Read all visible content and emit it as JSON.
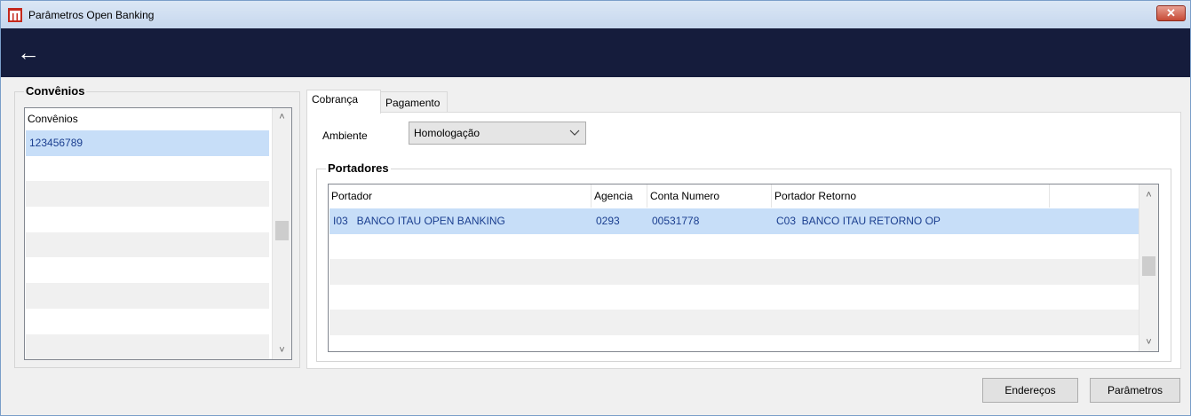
{
  "window": {
    "title": "Parâmetros Open Banking",
    "close_label": "✕"
  },
  "header": {
    "back_icon": "←"
  },
  "convenios": {
    "group_title": "Convênios",
    "column_header": "Convênios",
    "rows": [
      "123456789",
      "",
      "",
      "",
      "",
      "",
      "",
      "",
      ""
    ]
  },
  "tabs": [
    {
      "label": "Cobrança",
      "active": true
    },
    {
      "label": "Pagamento",
      "active": false
    }
  ],
  "cobranca": {
    "ambiente_label": "Ambiente",
    "ambiente_value": "Homologação",
    "portadores_title": "Portadores",
    "columns": [
      "Portador",
      "Agencia",
      "Conta Numero",
      "Portador Retorno"
    ],
    "rows": [
      {
        "portador": "I03   BANCO ITAU OPEN BANKING",
        "agencia": "0293",
        "conta": "00531778",
        "retorno": "C03  BANCO ITAU RETORNO OP"
      }
    ]
  },
  "buttons": {
    "enderecos": "Endereços",
    "parametros": "Parâmetros"
  },
  "colors": {
    "header_bg": "#151c3c",
    "selection_bg": "#c7def8",
    "selection_text": "#1a3e8f"
  }
}
